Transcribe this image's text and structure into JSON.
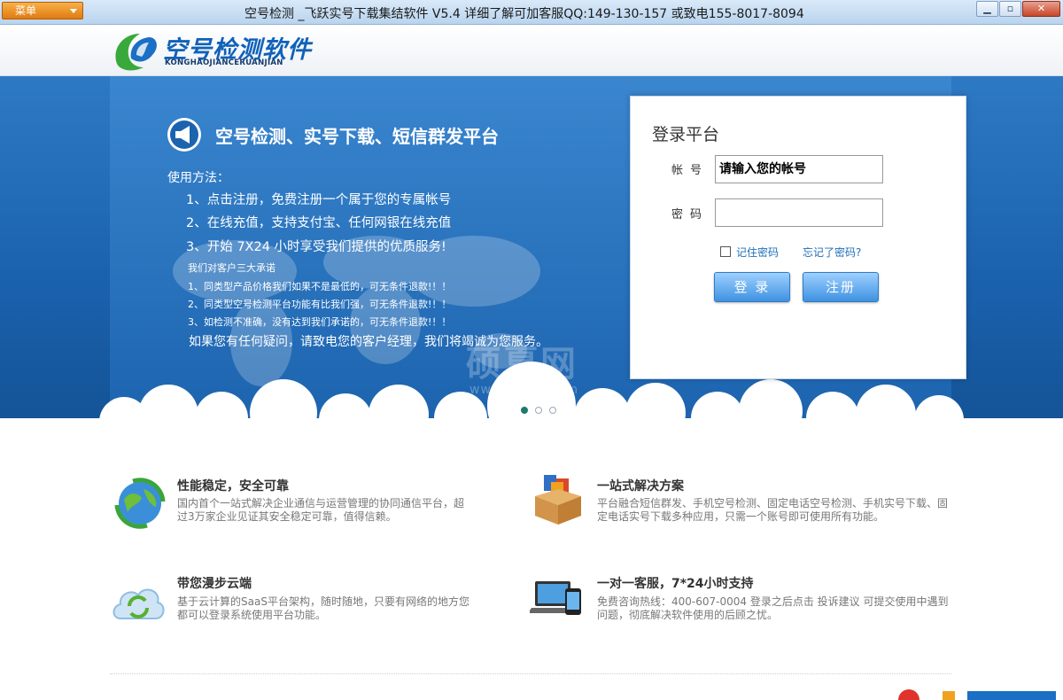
{
  "window": {
    "menu_label": "菜单",
    "title": "空号检测 _飞跃实号下载集结软件    V5.4      详细了解可加客服QQ:149-130-157 或致电155-8017-8094",
    "min_glyph": "▁",
    "max_glyph": "▫",
    "close_glyph": "✕"
  },
  "header": {
    "logo_name": "空号检测软件",
    "logo_sub": "KONGHAOJIANCERUANJIAN"
  },
  "banner": {
    "title": "空号检测、实号下载、短信群发平台",
    "usage_heading": "使用方法：",
    "steps": [
      "1、点击注册，免费注册一个属于您的专属帐号",
      "2、在线充值，支持支付宝、任何网银在线充值",
      "3、开始 7X24 小时享受我们提供的优质服务!"
    ],
    "promise_heading": "我们对客户三大承诺",
    "promises": [
      "1、同类型产品价格我们如果不是最低的，可无条件退款!！！",
      "2、同类型空号检测平台功能有比我们强，可无条件退款!！！",
      "3、如检测不准确，没有达到我们承诺的，可无条件退款!！！"
    ],
    "contact_line": "如果您有任何疑问，请致电您的客户经理，我们将竭诚为您服务。",
    "watermark": "硕夏网",
    "watermark_url": "www.sxiaw.com"
  },
  "login": {
    "title": "登录平台",
    "account_label": "帐号",
    "account_value": "请输入您的帐号",
    "password_label": "密码",
    "password_value": "",
    "remember_label": "记住密码",
    "forgot_label": "忘记了密码?",
    "login_button": "登 录",
    "register_button": "注册",
    "remember_checked": false
  },
  "features": [
    {
      "title": "性能稳定，安全可靠",
      "desc": "国内首个一站式解决企业通信与运营管理的协同通信平台，超过3万家企业见证其安全稳定可靠，值得信赖。",
      "icon": "globe-refresh-icon"
    },
    {
      "title": "一站式解决方案",
      "desc": "平台融合短信群发、手机空号检测、固定电话空号检测、手机实号下载、固定电话实号下载多种应用，只需一个账号即可使用所有功能。",
      "icon": "office-box-icon"
    },
    {
      "title": "带您漫步云端",
      "desc": "基于云计算的SaaS平台架构，随时随地，只要有网络的地方您都可以登录系统使用平台功能。",
      "icon": "cloud-sync-icon"
    },
    {
      "title": "一对一客服，7*24小时支持",
      "desc": "免费咨询热线：400-607-0004 登录之后点击 投诉建议 可提交使用中遇到问题，彻底解决软件使用的后顾之忧。",
      "icon": "laptop-phone-icon"
    }
  ],
  "slider": {
    "total": 3,
    "active": 1
  },
  "colors": {
    "banner": "#1f66b0",
    "button": "#3e91e1",
    "link": "#1f6fb8",
    "menu": "#e8891c"
  }
}
